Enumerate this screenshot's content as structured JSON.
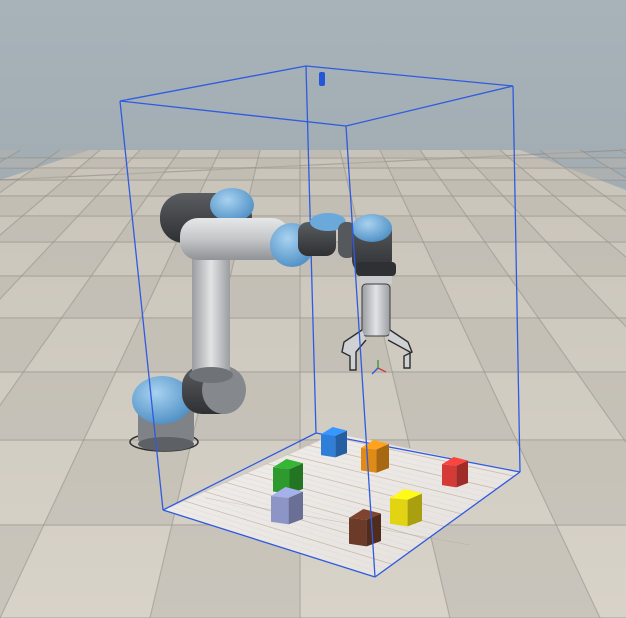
{
  "scene": {
    "sky_color": "#9fabb2",
    "floor_light": "#d9d4ca",
    "floor_dark": "#bcb7ad",
    "floor_grout": "#7f7c76",
    "bbox_color": "#2f5be0",
    "robot_blue": "#6aa9d9",
    "robot_gray": "#8a8d91",
    "robot_dark": "#3b3d40"
  },
  "cubes": [
    {
      "name": "blue",
      "color": "#2f7fd8"
    },
    {
      "name": "orange",
      "color": "#e08a18"
    },
    {
      "name": "red",
      "color": "#d43a36"
    },
    {
      "name": "green",
      "color": "#2e9a2e"
    },
    {
      "name": "lavender",
      "color": "#8d95c7"
    },
    {
      "name": "yellow",
      "color": "#e2d413"
    },
    {
      "name": "brown",
      "color": "#6b3a28"
    }
  ]
}
